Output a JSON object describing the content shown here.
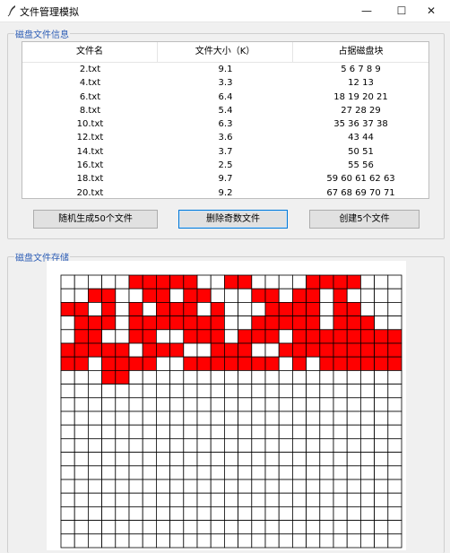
{
  "window": {
    "title": "文件管理模拟",
    "minimize": "—",
    "maximize": "☐",
    "close": "✕"
  },
  "info_section": {
    "label": "磁盘文件信息",
    "columns": [
      "文件名",
      "文件大小（K）",
      "占据磁盘块"
    ],
    "rows": [
      [
        "2.txt",
        "9.1",
        "5 6 7 8 9"
      ],
      [
        "4.txt",
        "3.3",
        "12 13"
      ],
      [
        "6.txt",
        "6.4",
        "18 19 20 21"
      ],
      [
        "8.txt",
        "5.4",
        "27 28 29"
      ],
      [
        "10.txt",
        "6.3",
        "35 36 37 38"
      ],
      [
        "12.txt",
        "3.6",
        "43 44"
      ],
      [
        "14.txt",
        "3.7",
        "50 51"
      ],
      [
        "16.txt",
        "2.5",
        "55 56"
      ],
      [
        "18.txt",
        "9.7",
        "59 60 61 62 63"
      ],
      [
        "20.txt",
        "9.2",
        "67 68 69 70 71"
      ]
    ]
  },
  "buttons": {
    "generate": "随机生成50个文件",
    "delete_odd": "删除奇数文件",
    "create5": "创建5个文件"
  },
  "storage_section": {
    "label": "磁盘文件存储"
  },
  "disk_grid": {
    "cols": 25,
    "rows": 20,
    "occupied_color": "#ff0000",
    "free_color": "#ffffff",
    "occupied_cells": [
      [
        0,
        5
      ],
      [
        0,
        6
      ],
      [
        0,
        7
      ],
      [
        0,
        8
      ],
      [
        0,
        9
      ],
      [
        0,
        12
      ],
      [
        0,
        13
      ],
      [
        0,
        18
      ],
      [
        0,
        19
      ],
      [
        0,
        20
      ],
      [
        0,
        21
      ],
      [
        1,
        2
      ],
      [
        1,
        3
      ],
      [
        1,
        6
      ],
      [
        1,
        7
      ],
      [
        1,
        9
      ],
      [
        1,
        10
      ],
      [
        1,
        14
      ],
      [
        1,
        15
      ],
      [
        1,
        17
      ],
      [
        1,
        18
      ],
      [
        1,
        20
      ],
      [
        2,
        0
      ],
      [
        2,
        1
      ],
      [
        2,
        3
      ],
      [
        2,
        5
      ],
      [
        2,
        7
      ],
      [
        2,
        8
      ],
      [
        2,
        9
      ],
      [
        2,
        11
      ],
      [
        2,
        15
      ],
      [
        2,
        16
      ],
      [
        2,
        17
      ],
      [
        2,
        18
      ],
      [
        2,
        20
      ],
      [
        2,
        21
      ],
      [
        3,
        1
      ],
      [
        3,
        2
      ],
      [
        3,
        3
      ],
      [
        3,
        5
      ],
      [
        3,
        6
      ],
      [
        3,
        7
      ],
      [
        3,
        8
      ],
      [
        3,
        9
      ],
      [
        3,
        10
      ],
      [
        3,
        11
      ],
      [
        3,
        14
      ],
      [
        3,
        15
      ],
      [
        3,
        16
      ],
      [
        3,
        17
      ],
      [
        3,
        18
      ],
      [
        3,
        20
      ],
      [
        3,
        21
      ],
      [
        3,
        22
      ],
      [
        4,
        1
      ],
      [
        4,
        2
      ],
      [
        4,
        5
      ],
      [
        4,
        6
      ],
      [
        4,
        9
      ],
      [
        4,
        10
      ],
      [
        4,
        11
      ],
      [
        4,
        13
      ],
      [
        4,
        14
      ],
      [
        4,
        15
      ],
      [
        4,
        17
      ],
      [
        4,
        18
      ],
      [
        4,
        19
      ],
      [
        4,
        20
      ],
      [
        4,
        21
      ],
      [
        4,
        22
      ],
      [
        4,
        23
      ],
      [
        4,
        24
      ],
      [
        5,
        0
      ],
      [
        5,
        1
      ],
      [
        5,
        2
      ],
      [
        5,
        3
      ],
      [
        5,
        4
      ],
      [
        5,
        6
      ],
      [
        5,
        7
      ],
      [
        5,
        8
      ],
      [
        5,
        11
      ],
      [
        5,
        12
      ],
      [
        5,
        13
      ],
      [
        5,
        16
      ],
      [
        5,
        17
      ],
      [
        5,
        18
      ],
      [
        5,
        19
      ],
      [
        5,
        20
      ],
      [
        5,
        21
      ],
      [
        5,
        22
      ],
      [
        5,
        23
      ],
      [
        5,
        24
      ],
      [
        6,
        0
      ],
      [
        6,
        1
      ],
      [
        6,
        3
      ],
      [
        6,
        4
      ],
      [
        6,
        5
      ],
      [
        6,
        6
      ],
      [
        6,
        9
      ],
      [
        6,
        10
      ],
      [
        6,
        11
      ],
      [
        6,
        12
      ],
      [
        6,
        13
      ],
      [
        6,
        14
      ],
      [
        6,
        15
      ],
      [
        6,
        17
      ],
      [
        6,
        19
      ],
      [
        6,
        20
      ],
      [
        6,
        21
      ],
      [
        6,
        22
      ],
      [
        6,
        23
      ],
      [
        6,
        24
      ],
      [
        7,
        3
      ],
      [
        7,
        4
      ]
    ]
  }
}
